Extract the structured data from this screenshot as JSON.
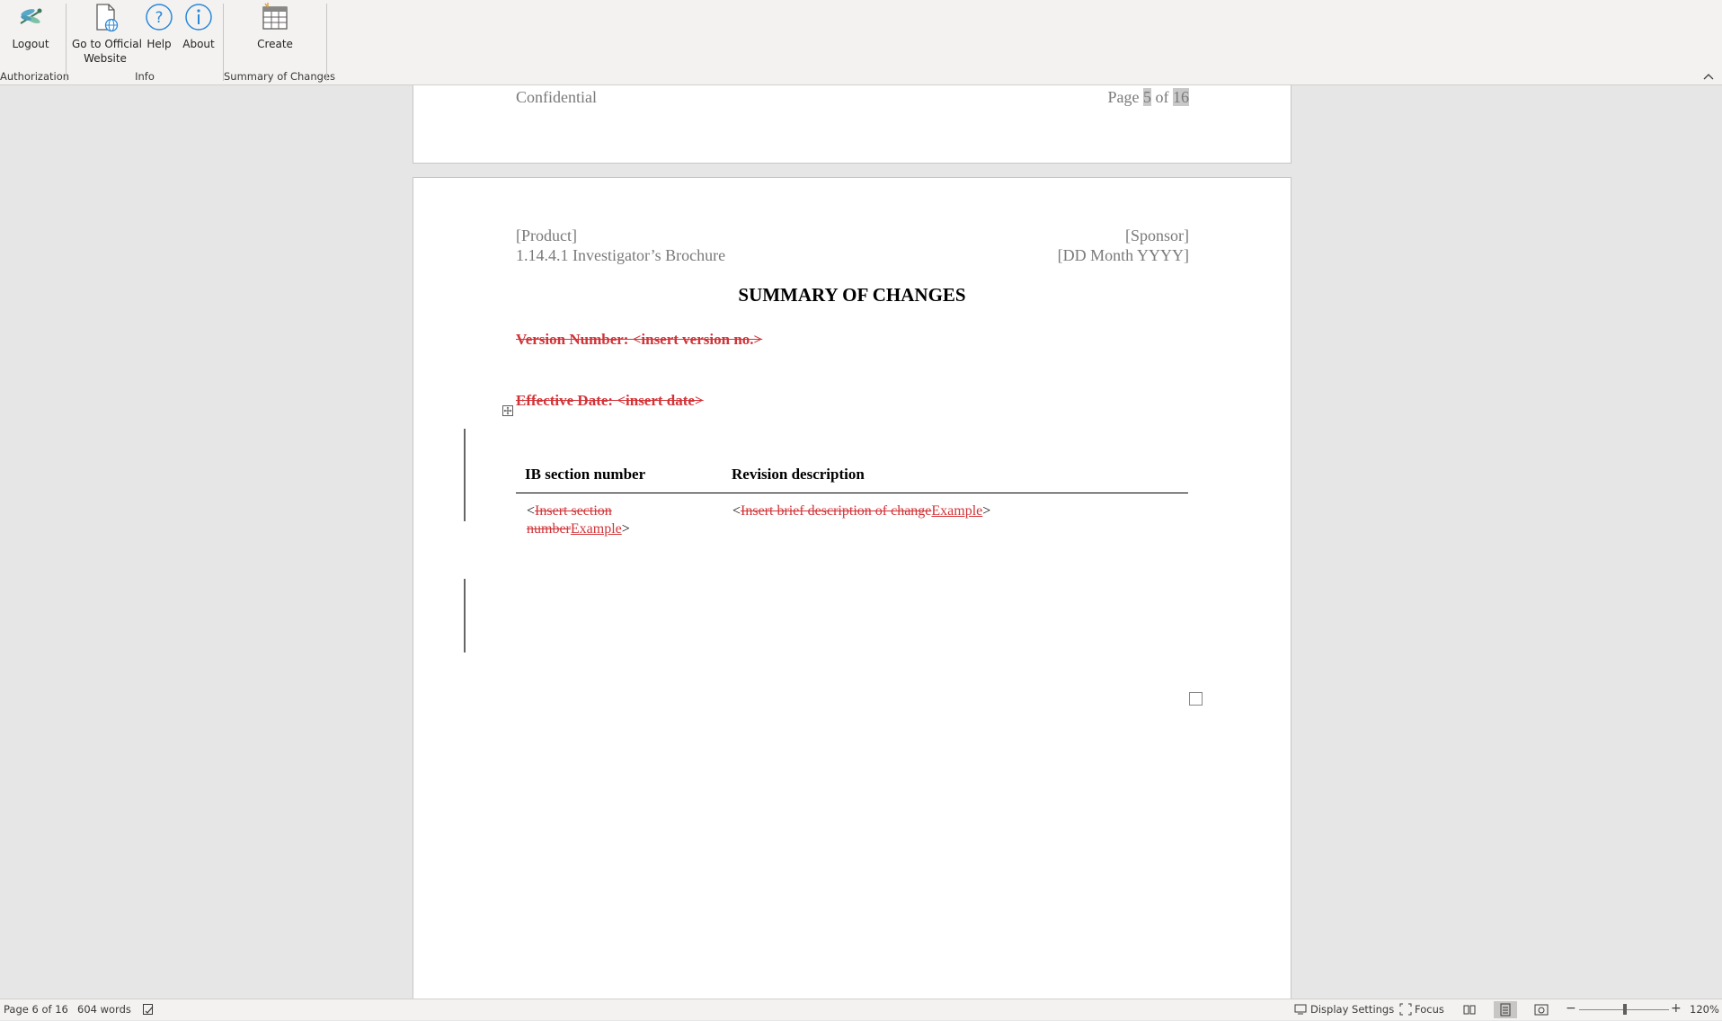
{
  "ribbon": {
    "groups": {
      "authorization": "Authorization",
      "info": "Info",
      "summary": "Summary of Changes"
    },
    "buttons": {
      "logout": "Logout",
      "official_website_line1": "Go to Official",
      "official_website_line2": "Website",
      "help": "Help",
      "about": "About",
      "create": "Create"
    }
  },
  "document": {
    "prev_page_footer": {
      "left": "Confidential",
      "page_prefix": "Page",
      "page_current": "5",
      "page_of": "of",
      "page_total": "16"
    },
    "header": {
      "product": "[Product]",
      "doc_name": "1.14.4.1 Investigator’s Brochure",
      "sponsor": "[Sponsor]",
      "date": "[DD Month YYYY]"
    },
    "title": "SUMMARY OF CHANGES",
    "version_line": "Version Number:  <insert version no.>",
    "effective_line": "Effective Date:  <insert date>",
    "table": {
      "col1_header": "IB section number",
      "col2_header": "Revision description",
      "row1": {
        "c1_open": "<",
        "c1_deleted_a": "Insert section",
        "c1_deleted_b": "number",
        "c1_inserted": "Example",
        "c1_close": ">",
        "c2_open": "<",
        "c2_deleted": "Insert brief description of change",
        "c2_inserted": "Example",
        "c2_close": ">"
      }
    }
  },
  "status": {
    "page": "Page 6 of 16",
    "words": "604 words",
    "display_settings": "Display Settings",
    "focus": "Focus",
    "zoom_minus": "−",
    "zoom_plus": "+",
    "zoom_level": "120%"
  },
  "colors": {
    "revision_red": "#d13438",
    "ribbon_bg": "#f3f2f1",
    "workspace_bg": "#e6e6e6",
    "icon_blue": "#2b88d8"
  },
  "icons": [
    "dragonfly-icon",
    "web-document-icon",
    "help-circle-icon",
    "info-circle-icon",
    "create-table-icon",
    "collapse-ribbon-icon",
    "table-move-handle-icon",
    "proofing-icon",
    "display-settings-icon",
    "focus-icon",
    "read-mode-icon",
    "print-layout-icon",
    "web-layout-icon"
  ]
}
